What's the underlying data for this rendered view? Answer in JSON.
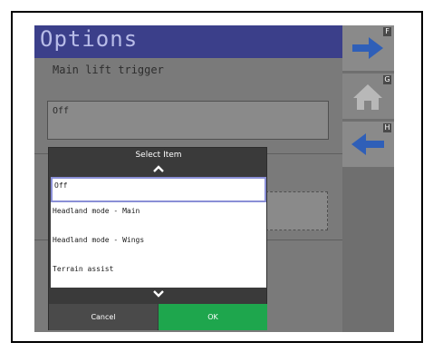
{
  "header": {
    "title": "Options"
  },
  "field": {
    "label": "Main lift trigger",
    "value": "Off"
  },
  "side_buttons": [
    {
      "key": "F",
      "icon": "arrow-right-icon"
    },
    {
      "key": "G",
      "icon": "home-icon"
    },
    {
      "key": "H",
      "icon": "arrow-left-icon"
    }
  ],
  "dialog": {
    "title": "Select Item",
    "items": [
      "Off",
      "Headland mode - Main",
      "Headland mode - Wings",
      "Terrain assist"
    ],
    "selected_index": 0,
    "cancel_label": "Cancel",
    "ok_label": "OK"
  },
  "colors": {
    "title_bar": "#3b3f8a",
    "title_text": "#b8bce8",
    "arrow_blue": "#2f5fb8",
    "ok_green": "#1ea64d",
    "selection_border": "#8a8fd6"
  }
}
